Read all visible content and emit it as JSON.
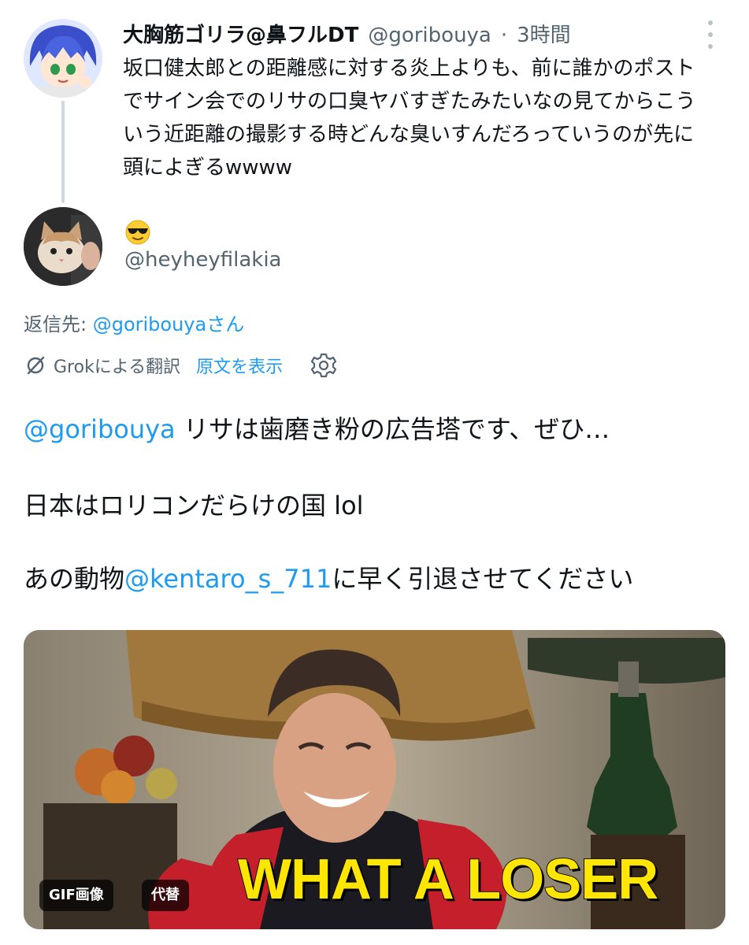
{
  "post1": {
    "display_name": "大胸筋ゴリラ@鼻フルDT",
    "handle": "@goribouya",
    "separator": "·",
    "time": "3時間",
    "text_lines": [
      "坂口健太郎との距離感に対する炎上よりも、前に誰かのポスト",
      "でサイン会でのリサの口臭ヤバすぎたみたいなの見てからこう",
      "いう近距離の撮影する時どんな臭いすんだろっていうのが先に",
      "頭によぎるwwww"
    ],
    "avatar_icon": "anime-avatar",
    "more_icon": "more-icon"
  },
  "post2": {
    "display_name_emoji": "😎",
    "handle": "@heyheyfilakia",
    "avatar_icon": "cat-avatar",
    "reply_prefix": "返信先: ",
    "reply_to": "@goribouyaさん",
    "translation": {
      "label": "Grokによる翻訳",
      "show_original": "原文を表示",
      "icon": "grok-icon",
      "settings_icon": "gear-icon"
    },
    "body": {
      "line1_mention": "@goribouya",
      "line1_text": " リサは歯磨き粉の広告塔です、ぜひ…",
      "line2": "日本はロリコンだらけの国 lol",
      "line3_prefix": "あの動物",
      "line3_mention": "@kentaro_s_711",
      "line3_suffix": "に早く引退させてください"
    },
    "media": {
      "caption": "WHAT A LOSER",
      "gif_badge": "GIF画像",
      "alt_badge": "代替"
    }
  },
  "colors": {
    "text": "#0f1419",
    "secondary": "#536471",
    "link": "#1d9bf0",
    "caption": "#ffe600"
  }
}
